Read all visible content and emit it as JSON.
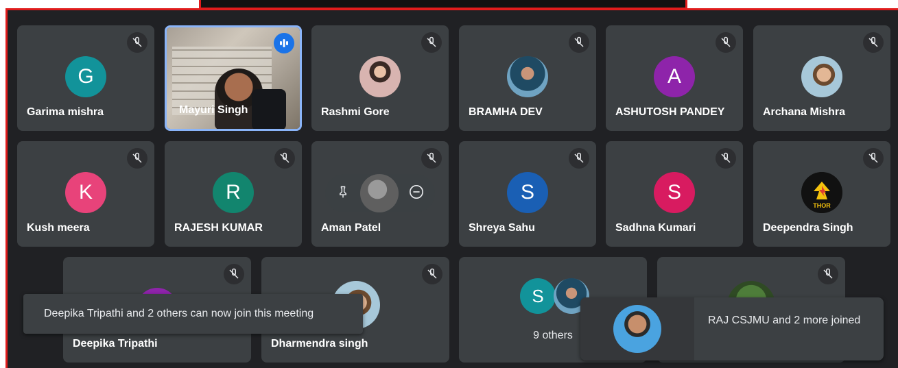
{
  "colors": {
    "frame": "#e01c1c",
    "background": "#202124",
    "tile": "#3c4043",
    "speaking": "#1a73e8"
  },
  "tiles": [
    {
      "name": "Garima mishra",
      "initial": "G",
      "color": "#12939a"
    },
    {
      "name": "Mayuri Singh",
      "initial": ""
    },
    {
      "name": "Rashmi Gore",
      "initial": ""
    },
    {
      "name": "BRAMHA DEV",
      "initial": ""
    },
    {
      "name": "ASHUTOSH PANDEY",
      "initial": "A",
      "color": "#8e24aa"
    },
    {
      "name": "Archana Mishra",
      "initial": ""
    },
    {
      "name": "Kush meera",
      "initial": "K",
      "color": "#e8437a"
    },
    {
      "name": "RAJESH KUMAR",
      "initial": "R",
      "color": "#12856e"
    },
    {
      "name": "Aman Patel",
      "initial": ""
    },
    {
      "name": "Shreya Sahu",
      "initial": "S",
      "color": "#1a5fb4"
    },
    {
      "name": "Sadhna Kumari",
      "initial": "S",
      "color": "#d81b60"
    },
    {
      "name": "Deependra Singh",
      "initial": "",
      "logo": "THOR"
    },
    {
      "name": "Deepika Tripathi",
      "initial": ""
    },
    {
      "name": "Dharmendra singh",
      "initial": ""
    },
    {
      "name": "9 others",
      "initial": "S",
      "color": "#12939a"
    }
  ],
  "toast": {
    "message": "Deepika Tripathi and 2 others can now join this meeting"
  },
  "join_notice": {
    "message": "RAJ CSJMU and 2 more joined"
  }
}
